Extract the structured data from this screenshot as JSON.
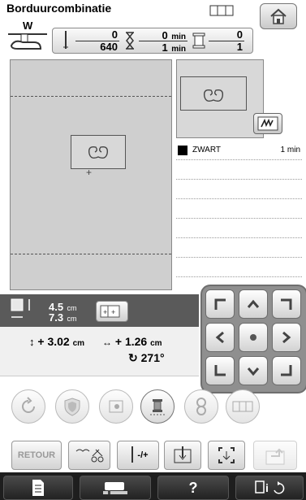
{
  "header": {
    "title": "Borduurcombinatie"
  },
  "stats": {
    "stitch_current": "0",
    "stitch_total": "640",
    "time_current": "0",
    "time_total": "1",
    "time_unit": "min",
    "color_current": "0",
    "color_total": "1"
  },
  "thread_list": [
    {
      "color": "#000000",
      "name": "ZWART",
      "time": "1 min"
    }
  ],
  "size": {
    "width": "4.5",
    "height": "7.3",
    "unit": "cm"
  },
  "position": {
    "vertical_offset": "+ 3.02",
    "horizontal_offset": "+ 1.26",
    "unit": "cm",
    "rotation": "271",
    "rotation_unit": "°"
  },
  "buttons": {
    "retour": "RETOUR",
    "density_label": "-/+",
    "help": "?"
  },
  "colors": {
    "canvas": "#cfcfcf",
    "panel_dark": "#5a5a5a",
    "bottom_bar": "#1e1e1e"
  }
}
